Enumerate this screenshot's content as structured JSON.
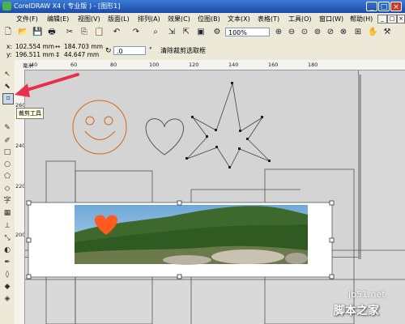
{
  "window": {
    "title": "CorelDRAW X4 ( 专业版 ) - [图形1]"
  },
  "menu": {
    "items": [
      "文件(F)",
      "编辑(E)",
      "视图(V)",
      "版面(L)",
      "排列(A)",
      "效果(C)",
      "位图(B)",
      "文本(X)",
      "表格(T)",
      "工具(O)",
      "窗口(W)",
      "帮助(H)"
    ]
  },
  "toolbar": {
    "zoom": "100%"
  },
  "property_bar": {
    "x_label": "x:",
    "x_value": "102.554 mm",
    "y_label": "y:",
    "y_value": "196.511 mm",
    "w_value": "184.703 mm",
    "h_value": "44.647 mm",
    "rotation": ".0",
    "rotation_unit": "°",
    "clear_crop": "清除裁剪选取框"
  },
  "tooltip": {
    "text": "裁剪工具"
  },
  "rulers": {
    "horizontal": [
      "40",
      "60",
      "80",
      "100",
      "120",
      "140",
      "160",
      "180"
    ],
    "vertical": [
      "260",
      "240",
      "220",
      "200"
    ],
    "unit": "毫米"
  },
  "tools": [
    "pick-icon",
    "shape-icon",
    "crop-icon",
    "zoom-icon",
    "freehand-icon",
    "smart-fill-icon",
    "rectangle-icon",
    "ellipse-icon",
    "polygon-icon",
    "text-icon",
    "table-icon",
    "dimension-icon",
    "connector-icon",
    "eyedropper-icon",
    "outline-icon",
    "fill-icon",
    "interactive-fill-icon"
  ],
  "watermark": {
    "line1": "jb51.net",
    "line2": "脚本之家"
  },
  "colors": {
    "title_bar": "#2a63c5",
    "smiley": "#d2691e",
    "heart_fill": "#ff5a1f",
    "arrow": "#e8304a"
  }
}
